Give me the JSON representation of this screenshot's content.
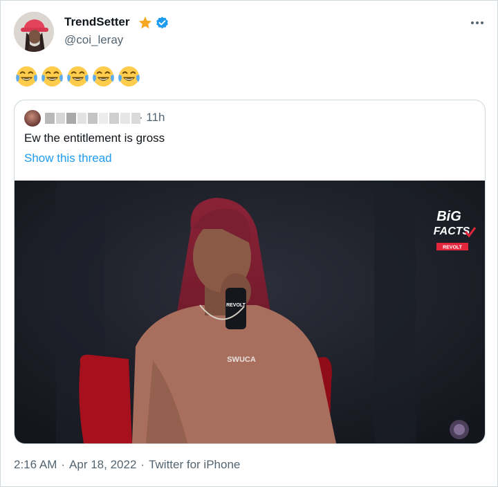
{
  "author": {
    "display_name": "TrendSetter",
    "handle": "@coi_leray",
    "badges": [
      "star-icon",
      "verified-icon"
    ]
  },
  "tweet": {
    "emojis": [
      "face-with-tears-of-joy",
      "face-with-tears-of-joy",
      "face-with-tears-of-joy",
      "face-with-tears-of-joy",
      "face-with-tears-of-joy"
    ]
  },
  "quoted_tweet": {
    "time": "· 11h",
    "text": "Ew the entitlement is gross",
    "show_thread_label": "Show this thread",
    "media_overlay": {
      "logo_line1": "BiG",
      "logo_line2": "FACTS",
      "logo_badge": "REVOLT",
      "shirt_text": "SWUCA"
    }
  },
  "footer": {
    "time": "2:16 AM",
    "sep1": "·",
    "date": "Apr 18, 2022",
    "sep2": "·",
    "source": "Twitter for iPhone"
  },
  "colors": {
    "link": "#1d9bf0",
    "secondary_text": "#536471",
    "verified": "#1d9bf0",
    "star": "#f7a823"
  }
}
